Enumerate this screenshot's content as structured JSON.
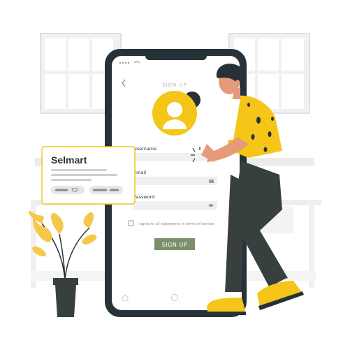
{
  "phone": {
    "screen_title": "SIGN UP",
    "fields": [
      {
        "label": "Username",
        "icon": "none"
      },
      {
        "label": "Email",
        "icon": "envelope-icon"
      },
      {
        "label": "Password",
        "icon": "eye-icon"
      }
    ],
    "terms_text": "I agree to all statements in terms of service",
    "terms_checked": false,
    "submit_label": "SIGN UP"
  },
  "card": {
    "brand": "Selmart"
  },
  "colors": {
    "accent_yellow": "#F5C518",
    "primary_green": "#7A8F6A",
    "phone_frame": "#263238",
    "pants": "#37403E",
    "skin": "#E59A7A",
    "window_gray": "#EBEBEB",
    "leaf_yellow": "#F6C84A"
  }
}
